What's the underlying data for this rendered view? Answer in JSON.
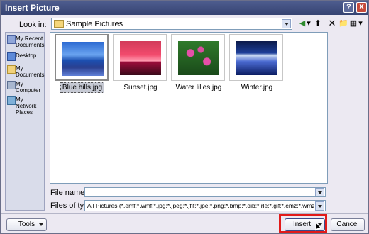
{
  "window": {
    "title": "Insert Picture",
    "help_label": "?",
    "close_label": "X"
  },
  "lookin": {
    "label": "Look in:",
    "value": "Sample Pictures"
  },
  "toolbar": {
    "back_glyph": "◀",
    "up_glyph": "⬆",
    "delete_glyph": "✕",
    "new_folder_glyph": "📁",
    "views_glyph": "▦",
    "arrow_glyph": "▾"
  },
  "places": [
    {
      "label": "My Recent Documents",
      "icon": "recent-documents-icon"
    },
    {
      "label": "Desktop",
      "icon": "desktop-icon"
    },
    {
      "label": "My Documents",
      "icon": "my-documents-icon"
    },
    {
      "label": "My Computer",
      "icon": "my-computer-icon"
    },
    {
      "label": "My Network Places",
      "icon": "network-places-icon"
    }
  ],
  "files": [
    {
      "name": "Blue hills.jpg",
      "selected": true
    },
    {
      "name": "Sunset.jpg",
      "selected": false
    },
    {
      "name": "Water lilies.jpg",
      "selected": false
    },
    {
      "name": "Winter.jpg",
      "selected": false
    }
  ],
  "filename": {
    "label": "File name:",
    "value": ""
  },
  "filetype": {
    "label": "Files of type:",
    "value": "All Pictures (*.emf;*.wmf;*.jpg;*.jpeg;*.jfif;*.jpe;*.png;*.bmp;*.dib;*.rle;*.gif;*.emz;*.wmz;*.pcz"
  },
  "buttons": {
    "tools": "Tools",
    "insert": "Insert",
    "cancel": "Cancel"
  },
  "colors": {
    "highlight": "#e11a1a",
    "titlebar": "#3f4c7e"
  }
}
